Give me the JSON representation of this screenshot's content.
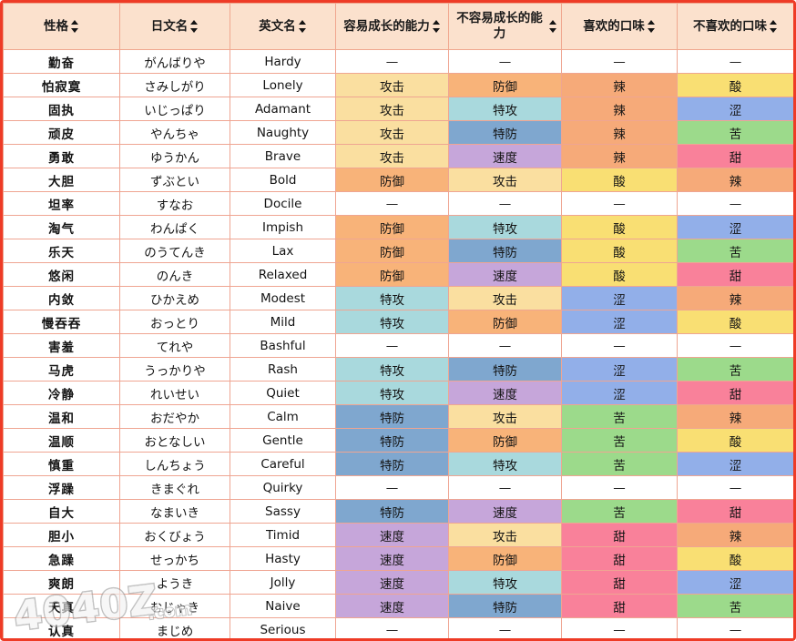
{
  "table": {
    "columns": [
      {
        "label": "性格",
        "sort_icon": "sort-updown-icon"
      },
      {
        "label": "日文名",
        "sort_icon": "sort-updown-icon"
      },
      {
        "label": "英文名",
        "sort_icon": "sort-updown-icon"
      },
      {
        "label": "容易成长的能力",
        "sort_icon": "sort-updown-icon"
      },
      {
        "label": "不容易成长的能力",
        "sort_icon": "sort-updown-icon"
      },
      {
        "label": "喜欢的口味",
        "sort_icon": "sort-updown-icon"
      },
      {
        "label": "不喜欢的口味",
        "sort_icon": "sort-updown-icon"
      }
    ],
    "dash": "—",
    "rows": [
      {
        "cn": "勤奋",
        "jp": "がんばりや",
        "en": "Hardy",
        "up": "—",
        "down": "—",
        "like": "—",
        "dislike": "—",
        "up_key": "none",
        "down_key": "none",
        "like_key": "none",
        "dislike_key": "none"
      },
      {
        "cn": "怕寂寞",
        "jp": "さみしがり",
        "en": "Lonely",
        "up": "攻击",
        "down": "防御",
        "like": "辣",
        "dislike": "酸",
        "up_key": "atk",
        "down_key": "def",
        "like_key": "spicy",
        "dislike_key": "sour"
      },
      {
        "cn": "固执",
        "jp": "いじっぱり",
        "en": "Adamant",
        "up": "攻击",
        "down": "特攻",
        "like": "辣",
        "dislike": "涩",
        "up_key": "atk",
        "down_key": "spatk",
        "like_key": "spicy",
        "dislike_key": "astr"
      },
      {
        "cn": "顽皮",
        "jp": "やんちゃ",
        "en": "Naughty",
        "up": "攻击",
        "down": "特防",
        "like": "辣",
        "dislike": "苦",
        "up_key": "atk",
        "down_key": "spdef",
        "like_key": "spicy",
        "dislike_key": "bitter"
      },
      {
        "cn": "勇敢",
        "jp": "ゆうかん",
        "en": "Brave",
        "up": "攻击",
        "down": "速度",
        "like": "辣",
        "dislike": "甜",
        "up_key": "atk",
        "down_key": "speed",
        "like_key": "spicy",
        "dislike_key": "sweet"
      },
      {
        "cn": "大胆",
        "jp": "ずぶとい",
        "en": "Bold",
        "up": "防御",
        "down": "攻击",
        "like": "酸",
        "dislike": "辣",
        "up_key": "def",
        "down_key": "atk",
        "like_key": "sour",
        "dislike_key": "spicy"
      },
      {
        "cn": "坦率",
        "jp": "すなお",
        "en": "Docile",
        "up": "—",
        "down": "—",
        "like": "—",
        "dislike": "—",
        "up_key": "none",
        "down_key": "none",
        "like_key": "none",
        "dislike_key": "none"
      },
      {
        "cn": "淘气",
        "jp": "わんぱく",
        "en": "Impish",
        "up": "防御",
        "down": "特攻",
        "like": "酸",
        "dislike": "涩",
        "up_key": "def",
        "down_key": "spatk",
        "like_key": "sour",
        "dislike_key": "astr"
      },
      {
        "cn": "乐天",
        "jp": "のうてんき",
        "en": "Lax",
        "up": "防御",
        "down": "特防",
        "like": "酸",
        "dislike": "苦",
        "up_key": "def",
        "down_key": "spdef",
        "like_key": "sour",
        "dislike_key": "bitter"
      },
      {
        "cn": "悠闲",
        "jp": "のんき",
        "en": "Relaxed",
        "up": "防御",
        "down": "速度",
        "like": "酸",
        "dislike": "甜",
        "up_key": "def",
        "down_key": "speed",
        "like_key": "sour",
        "dislike_key": "sweet"
      },
      {
        "cn": "内敛",
        "jp": "ひかえめ",
        "en": "Modest",
        "up": "特攻",
        "down": "攻击",
        "like": "涩",
        "dislike": "辣",
        "up_key": "spatk",
        "down_key": "atk",
        "like_key": "astr",
        "dislike_key": "spicy"
      },
      {
        "cn": "慢吞吞",
        "jp": "おっとり",
        "en": "Mild",
        "up": "特攻",
        "down": "防御",
        "like": "涩",
        "dislike": "酸",
        "up_key": "spatk",
        "down_key": "def",
        "like_key": "astr",
        "dislike_key": "sour"
      },
      {
        "cn": "害羞",
        "jp": "てれや",
        "en": "Bashful",
        "up": "—",
        "down": "—",
        "like": "—",
        "dislike": "—",
        "up_key": "none",
        "down_key": "none",
        "like_key": "none",
        "dislike_key": "none"
      },
      {
        "cn": "马虎",
        "jp": "うっかりや",
        "en": "Rash",
        "up": "特攻",
        "down": "特防",
        "like": "涩",
        "dislike": "苦",
        "up_key": "spatk",
        "down_key": "spdef",
        "like_key": "astr",
        "dislike_key": "bitter"
      },
      {
        "cn": "冷静",
        "jp": "れいせい",
        "en": "Quiet",
        "up": "特攻",
        "down": "速度",
        "like": "涩",
        "dislike": "甜",
        "up_key": "spatk",
        "down_key": "speed",
        "like_key": "astr",
        "dislike_key": "sweet"
      },
      {
        "cn": "温和",
        "jp": "おだやか",
        "en": "Calm",
        "up": "特防",
        "down": "攻击",
        "like": "苦",
        "dislike": "辣",
        "up_key": "spdef",
        "down_key": "atk",
        "like_key": "bitter",
        "dislike_key": "spicy"
      },
      {
        "cn": "温顺",
        "jp": "おとなしい",
        "en": "Gentle",
        "up": "特防",
        "down": "防御",
        "like": "苦",
        "dislike": "酸",
        "up_key": "spdef",
        "down_key": "def",
        "like_key": "bitter",
        "dislike_key": "sour"
      },
      {
        "cn": "慎重",
        "jp": "しんちょう",
        "en": "Careful",
        "up": "特防",
        "down": "特攻",
        "like": "苦",
        "dislike": "涩",
        "up_key": "spdef",
        "down_key": "spatk",
        "like_key": "bitter",
        "dislike_key": "astr"
      },
      {
        "cn": "浮躁",
        "jp": "きまぐれ",
        "en": "Quirky",
        "up": "—",
        "down": "—",
        "like": "—",
        "dislike": "—",
        "up_key": "none",
        "down_key": "none",
        "like_key": "none",
        "dislike_key": "none"
      },
      {
        "cn": "自大",
        "jp": "なまいき",
        "en": "Sassy",
        "up": "特防",
        "down": "速度",
        "like": "苦",
        "dislike": "甜",
        "up_key": "spdef",
        "down_key": "speed",
        "like_key": "bitter",
        "dislike_key": "sweet"
      },
      {
        "cn": "胆小",
        "jp": "おくびょう",
        "en": "Timid",
        "up": "速度",
        "down": "攻击",
        "like": "甜",
        "dislike": "辣",
        "up_key": "speed",
        "down_key": "atk",
        "like_key": "sweet",
        "dislike_key": "spicy"
      },
      {
        "cn": "急躁",
        "jp": "せっかち",
        "en": "Hasty",
        "up": "速度",
        "down": "防御",
        "like": "甜",
        "dislike": "酸",
        "up_key": "speed",
        "down_key": "def",
        "like_key": "sweet",
        "dislike_key": "sour"
      },
      {
        "cn": "爽朗",
        "jp": "ようき",
        "en": "Jolly",
        "up": "速度",
        "down": "特攻",
        "like": "甜",
        "dislike": "涩",
        "up_key": "speed",
        "down_key": "spatk",
        "like_key": "sweet",
        "dislike_key": "astr"
      },
      {
        "cn": "天真",
        "jp": "むじゃき",
        "en": "Naive",
        "up": "速度",
        "down": "特防",
        "like": "甜",
        "dislike": "苦",
        "up_key": "speed",
        "down_key": "spdef",
        "like_key": "sweet",
        "dislike_key": "bitter"
      },
      {
        "cn": "认真",
        "jp": "まじめ",
        "en": "Serious",
        "up": "—",
        "down": "—",
        "like": "—",
        "dislike": "—",
        "up_key": "none",
        "down_key": "none",
        "like_key": "none",
        "dislike_key": "none"
      }
    ]
  },
  "watermark": {
    "text": "4040Z",
    "suffix": ".com"
  },
  "colors": {
    "frame": "#EE3B26",
    "header_bg": "#FBE1CD",
    "grid": "#EFA592",
    "attack": "#FADFA0",
    "defense": "#F8B379",
    "sp_attack": "#A9D9DD",
    "sp_defense": "#7FA7CF",
    "speed": "#C6A6DA",
    "spicy": "#F6AA79",
    "sour": "#F9DF73",
    "astringent": "#92AFE9",
    "bitter": "#9CDA8B",
    "sweet": "#F9819A"
  }
}
